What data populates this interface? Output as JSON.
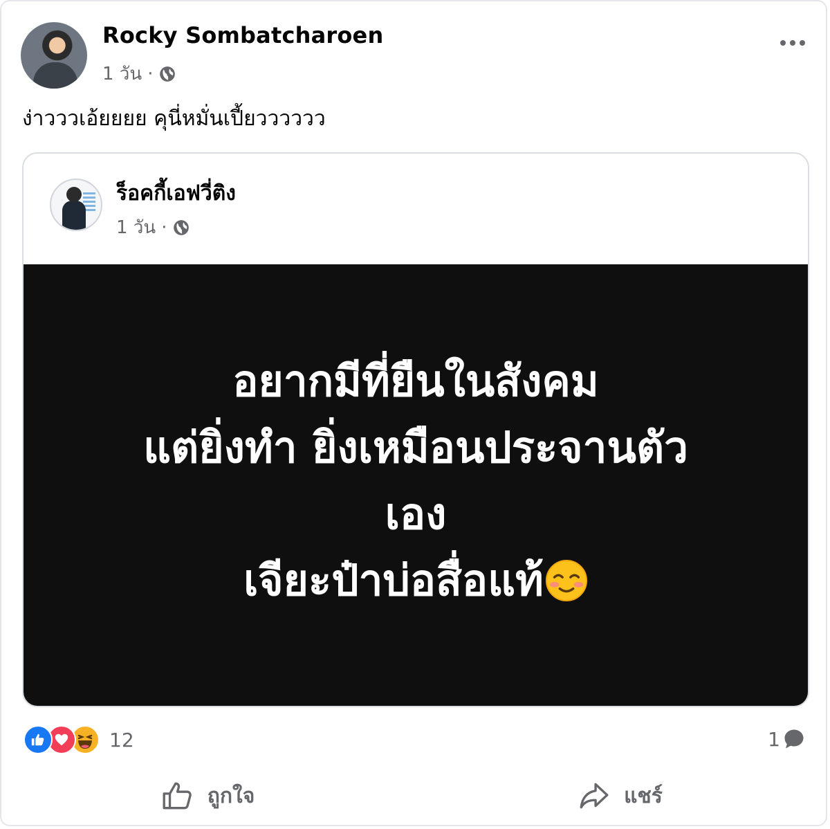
{
  "post": {
    "author": "Rocky Sombatcharoen",
    "time": "1 วัน",
    "separator": "·",
    "caption": "ง่าวววเอ้ยยยย คุนี่หมั่นเปี้ยวววววว"
  },
  "shared": {
    "author": "ร็อคกี้เอฟวี่ติง",
    "time": "1 วัน",
    "separator": "·",
    "media_lines": [
      "อยากมีที่ยืนในสังคม",
      "แต่ยิ่งทำ ยิ่งเหมือนประจานตัว",
      "เอง",
      "เจียะป๋าบ่อสื่อแท้"
    ]
  },
  "stats": {
    "reaction_count": "12",
    "comment_count": "1"
  },
  "actions": {
    "like_label": "ถูกใจ",
    "share_label": "แชร์"
  },
  "icons": [
    "more-options-icon",
    "globe-icon",
    "like-reaction-icon",
    "love-reaction-icon",
    "haha-reaction-icon",
    "comment-icon",
    "thumbs-up-icon",
    "share-arrow-icon",
    "smiling-emoji"
  ],
  "colors": {
    "like_blue": "#1877f2",
    "love_red": "#f33e58",
    "haha_yellow": "#f7b125",
    "muted_text": "#65676b",
    "media_background": "#0f0f0f"
  }
}
